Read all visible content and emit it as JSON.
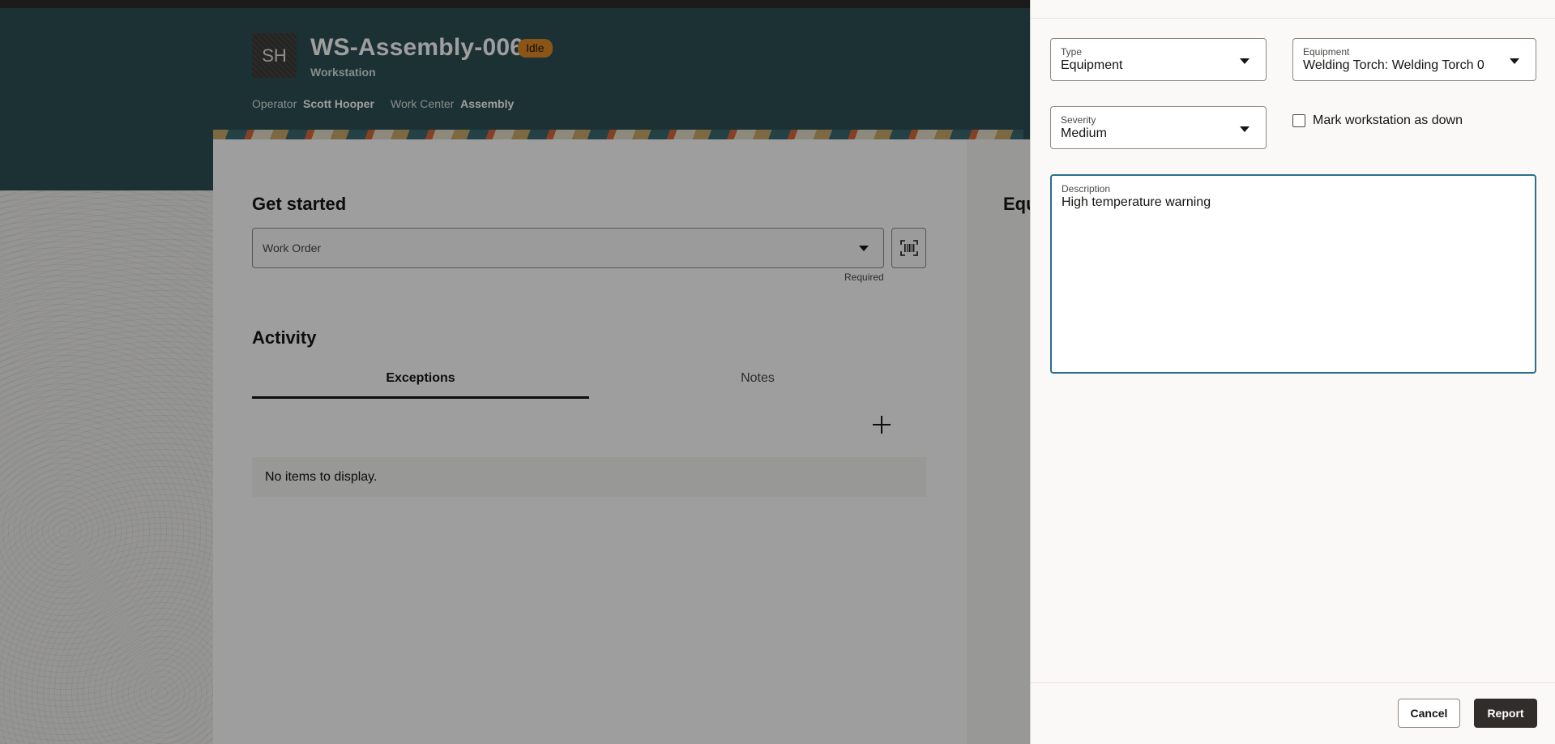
{
  "workstation": {
    "avatar_initials": "SH",
    "title": "WS-Assembly-006",
    "status": "Idle",
    "subtitle": "Workstation",
    "operator_label": "Operator",
    "operator_value": "Scott Hooper",
    "workcenter_label": "Work Center",
    "workcenter_value": "Assembly"
  },
  "get_started": {
    "heading": "Get started",
    "work_order_placeholder": "Work Order",
    "required_text": "Required"
  },
  "activity": {
    "heading": "Activity",
    "tabs": [
      "Exceptions",
      "Notes"
    ],
    "empty_text": "No items to display."
  },
  "side_card": {
    "heading_fragment": "Equ"
  },
  "drawer": {
    "type_label": "Type",
    "type_value": "Equipment",
    "equipment_label": "Equipment",
    "equipment_value": "Welding Torch: Welding Torch 0",
    "severity_label": "Severity",
    "severity_value": "Medium",
    "checkbox_label": "Mark workstation as down",
    "description_label": "Description",
    "description_value": "High temperature warning",
    "cancel_label": "Cancel",
    "report_label": "Report"
  },
  "colors": {
    "hero_bg": "#2e4f54",
    "badge_bg": "#e08a26",
    "primary_button": "#312d2a",
    "focus_border": "#2b6f8a"
  }
}
